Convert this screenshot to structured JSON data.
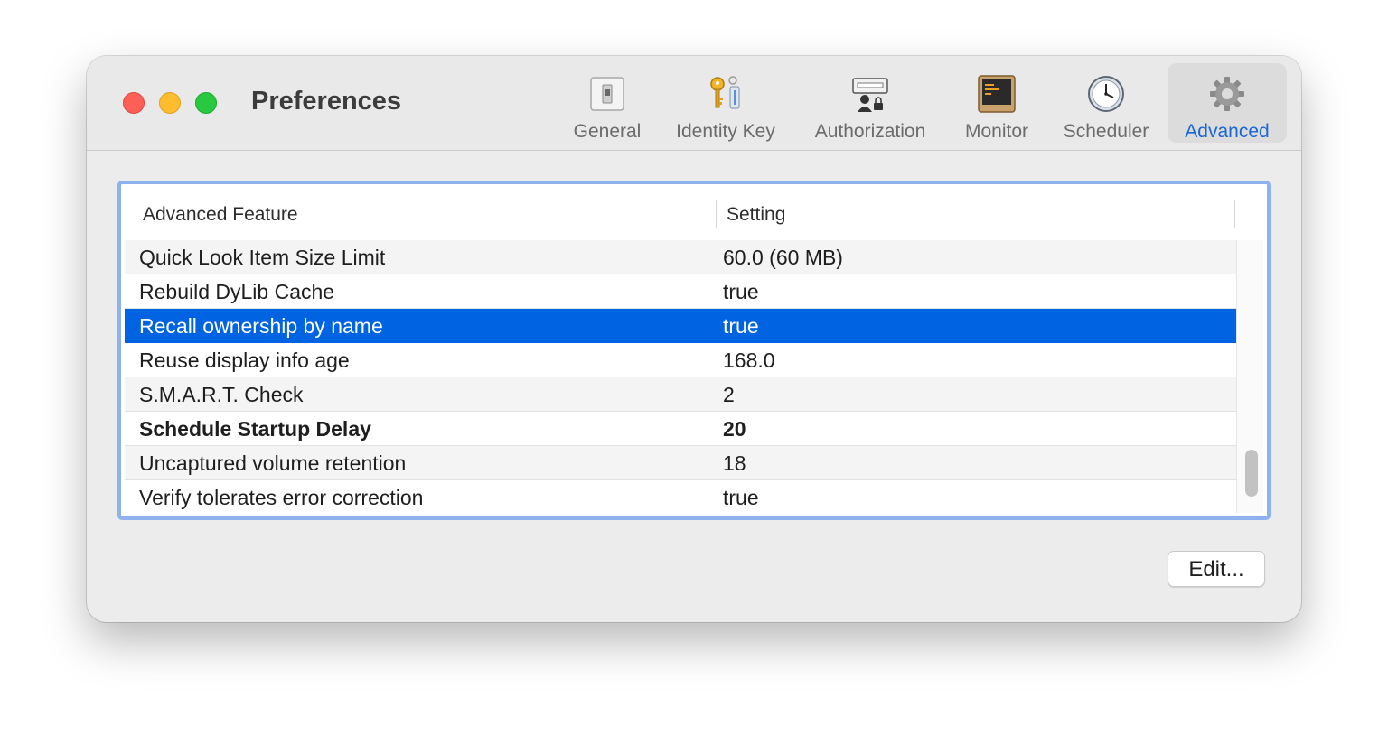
{
  "window": {
    "title": "Preferences"
  },
  "toolbar": {
    "tabs": [
      {
        "label": "General",
        "icon": "general-switch-icon",
        "selected": false
      },
      {
        "label": "Identity Key",
        "icon": "keys-icon",
        "selected": false
      },
      {
        "label": "Authorization",
        "icon": "authorization-keyboard-icon",
        "selected": false
      },
      {
        "label": "Monitor",
        "icon": "monitor-terminal-icon",
        "selected": false
      },
      {
        "label": "Scheduler",
        "icon": "clock-icon",
        "selected": false
      },
      {
        "label": "Advanced",
        "icon": "gear-icon",
        "selected": true
      }
    ]
  },
  "table": {
    "columns": [
      "Advanced Feature",
      "Setting"
    ],
    "rows": [
      {
        "feature": "Quick Look Item Size Limit",
        "setting": "60.0 (60 MB)"
      },
      {
        "feature": "Rebuild DyLib Cache",
        "setting": "true"
      },
      {
        "feature": "Recall ownership by name",
        "setting": "true",
        "selected": true
      },
      {
        "feature": "Reuse display info age",
        "setting": "168.0"
      },
      {
        "feature": "S.M.A.R.T. Check",
        "setting": "2"
      },
      {
        "feature": "Schedule Startup Delay",
        "setting": "20",
        "bold": true
      },
      {
        "feature": "Uncaptured volume retention",
        "setting": "18"
      },
      {
        "feature": "Verify tolerates error correction",
        "setting": "true"
      }
    ]
  },
  "buttons": {
    "edit": "Edit..."
  },
  "colors": {
    "selection": "#0063e1",
    "accent": "#1a66d6",
    "focus_ring": "#8db2ee"
  }
}
